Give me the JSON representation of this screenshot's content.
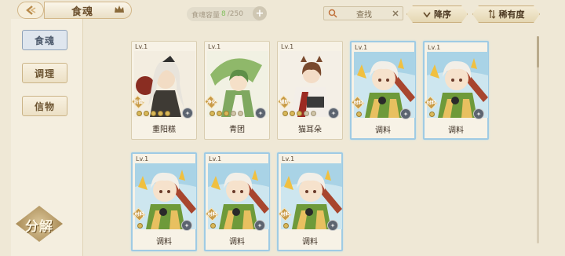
{
  "header": {
    "title": "食魂",
    "capacity_label": "食魂容量",
    "capacity_current": "8",
    "capacity_max": "/250",
    "search_placeholder": "查找",
    "sort_desc_label": "降序",
    "sort_rarity_label": "稀有度"
  },
  "sidebar": {
    "items": [
      {
        "label": "食魂",
        "active": true
      },
      {
        "label": "调理",
        "active": false
      },
      {
        "label": "信物",
        "active": false
      }
    ],
    "decompose_label": "分解"
  },
  "cards": [
    {
      "level": "Lv.1",
      "name": "重阳糕",
      "role": "防御",
      "stars_filled": 5,
      "stars_total": 5,
      "frame": "plain",
      "portrait": "dark-robed-elder-icon"
    },
    {
      "level": "Lv.1",
      "name": "青团",
      "role": "净化",
      "stars_filled": 3,
      "stars_total": 5,
      "frame": "plain",
      "portrait": "green-umbrella-boy-icon"
    },
    {
      "level": "Lv.1",
      "name": "猫耳朵",
      "role": "辅助",
      "stars_filled": 3,
      "stars_total": 5,
      "frame": "plain",
      "portrait": "brown-hair-youth-icon"
    },
    {
      "level": "Lv.1",
      "name": "调料",
      "role": "材料",
      "stars_filled": 1,
      "stars_total": 1,
      "frame": "blue",
      "portrait": "chibi-material-icon"
    },
    {
      "level": "Lv.1",
      "name": "调料",
      "role": "材料",
      "stars_filled": 1,
      "stars_total": 1,
      "frame": "blue",
      "portrait": "chibi-material-icon"
    },
    {
      "level": "Lv.1",
      "name": "调料",
      "role": "材料",
      "stars_filled": 1,
      "stars_total": 1,
      "frame": "blue",
      "portrait": "chibi-material-icon"
    },
    {
      "level": "Lv.1",
      "name": "调料",
      "role": "材料",
      "stars_filled": 1,
      "stars_total": 1,
      "frame": "blue",
      "portrait": "chibi-material-icon"
    },
    {
      "level": "Lv.1",
      "name": "调料",
      "role": "材料",
      "stars_filled": 1,
      "stars_total": 1,
      "frame": "blue",
      "portrait": "chibi-material-icon"
    }
  ],
  "colors": {
    "background": "#efe8d6",
    "accent_gold": "#c89a46",
    "capacity_current": "#7fbf5a",
    "blue_frame": "#9fcbe4"
  }
}
